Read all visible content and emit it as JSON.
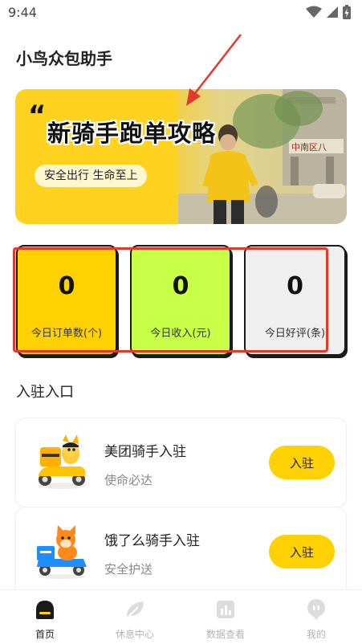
{
  "status_bar": {
    "time": "9:44"
  },
  "app_title": "小鸟众包助手",
  "banner": {
    "quote_mark": "“",
    "title": "新骑手跑单攻略",
    "slogan": "安全出行 生命至上",
    "sign_text": "中南区八"
  },
  "stats": [
    {
      "value": "0",
      "label": "今日订单数(个)",
      "color": "#ffd100"
    },
    {
      "value": "0",
      "label": "今日收入(元)",
      "color": "#c8ff47"
    },
    {
      "value": "0",
      "label": "今日好评(条)",
      "color": "#efefef"
    }
  ],
  "section_title": "入驻入口",
  "entries": [
    {
      "name": "美团骑手入驻",
      "subtitle": "使命必达",
      "button": "入驻",
      "icon": "kangaroo-scooter-icon"
    },
    {
      "name": "饿了么骑手入驻",
      "subtitle": "安全护送",
      "button": "入驻",
      "icon": "fox-scooter-icon"
    }
  ],
  "nav": [
    {
      "label": "首页",
      "icon": "home-icon",
      "active": true
    },
    {
      "label": "休息中心",
      "icon": "leaf-icon",
      "active": false
    },
    {
      "label": "数据查看",
      "icon": "bar-chart-icon",
      "active": false
    },
    {
      "label": "我的",
      "icon": "profile-icon",
      "active": false
    }
  ],
  "colors": {
    "accent": "#ffd100",
    "annotation": "#e03a2e"
  }
}
